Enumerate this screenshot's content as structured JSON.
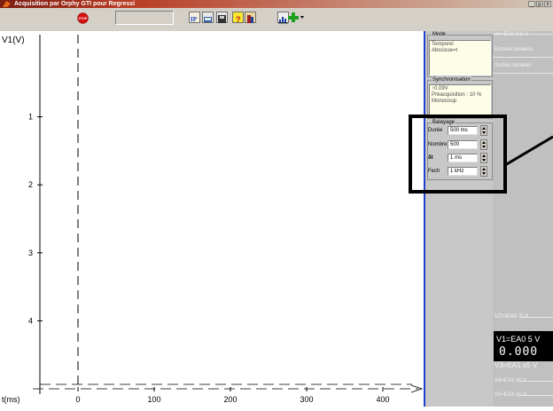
{
  "window": {
    "title": "Acquisition par Orphy GTI pour Regressi",
    "buttons": [
      "_",
      "µ",
      "x"
    ]
  },
  "toolbar": {
    "stop_label": "STOP",
    "items": [
      "ip-icon",
      "open-folder-icon",
      "save-disk-icon",
      "help-icon",
      "calibration-icon",
      "bar-chart-icon",
      "add-channel-icon"
    ]
  },
  "plot": {
    "y_axis_label": "V1(V)",
    "x_axis_label": "t(ms)",
    "y_ticks": [
      "4",
      "3",
      "2",
      "1"
    ],
    "x_ticks": [
      "0",
      "100",
      "200",
      "300",
      "400"
    ]
  },
  "chart_data": {
    "type": "line",
    "xlabel": "t(ms)",
    "ylabel": "V1(V)",
    "xlim": [
      -50,
      450
    ],
    "ylim": [
      0,
      5
    ],
    "x_ticks": [
      0,
      100,
      200,
      300,
      400
    ],
    "y_ticks": [
      1,
      2,
      3,
      4
    ],
    "series": []
  },
  "panel": {
    "mode": {
      "title": "Mode",
      "lines": [
        "Temporel",
        "Abscisse=t"
      ]
    },
    "sync": {
      "title": "Synchronisation",
      "lines": [
        "↑0.09V",
        "Préacquisition : 10 %",
        "Monocoup"
      ]
    },
    "balayage": {
      "title": "Balayage",
      "rows": [
        {
          "label": "Durée",
          "value": "500 ms"
        },
        {
          "label": "Nombre",
          "value": "500"
        },
        {
          "label": "δt",
          "value": "1 ms"
        },
        {
          "label": "Fech",
          "value": "1 kHz"
        }
      ]
    }
  },
  "strip": {
    "top_item": "V≠=EA0 0.5 V",
    "entrees": "Entrées binaires",
    "sorties": "Sorties binaires",
    "v2": "V2=EA0 5 V",
    "v1_label": "V1=EA0 5 V",
    "v1_value": "0.000",
    "v3": "V3=EA1 ±5 V",
    "v4": "V4=EA2 ±5 V",
    "v5": "V5=EA3 ±5 V"
  },
  "colors": {
    "title_bar": "#b83a22",
    "panel_border": "#2040d0",
    "display_bg": "#000000"
  }
}
